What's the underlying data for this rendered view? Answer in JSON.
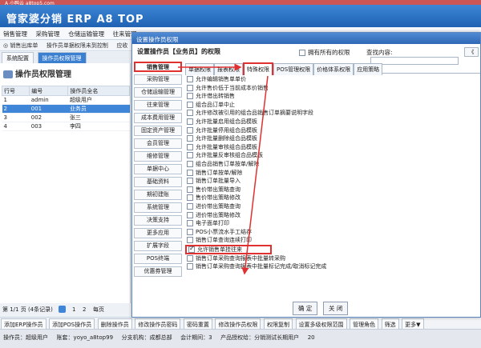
{
  "top_strip": "A 小鸭云 a8top5.com",
  "app_title": "管家婆分销 ERP A8 TOP",
  "menubar": [
    "销售管理",
    "采购管理",
    "仓储运输管理",
    "往来管理"
  ],
  "toolbar2": [
    "◎ 销售出库单",
    "操作员单据权限未到控制",
    "应收"
  ],
  "tabs": [
    "系统配置",
    "操作员权限管理"
  ],
  "left_panel": {
    "title": "操作员权限管理",
    "columns": [
      "行号",
      "编号",
      "操作员全名"
    ],
    "rows": [
      {
        "no": "1",
        "code": "admin",
        "name": "超级用户"
      },
      {
        "no": "2",
        "code": "001",
        "name": "业务员"
      },
      {
        "no": "3",
        "code": "002",
        "name": "张三"
      },
      {
        "no": "4",
        "code": "003",
        "name": "李四"
      }
    ]
  },
  "pager": {
    "info": "第 1/1 页 (4条记录)",
    "page": "1",
    "next": "2",
    "per": "每页"
  },
  "bottom_buttons": [
    "添加ERP操作员",
    "添加POS操作员",
    "删除操作员",
    "修改操作员密码",
    "密码重置",
    "修改操作员权限",
    "权限复制",
    "设置多级权限范围",
    "管理角色",
    "筛选",
    "更多▼"
  ],
  "status": [
    "操作员：超级用户",
    "账套：yoyo_a8top99",
    "分支机构：成都总部",
    "会计期间：3",
    "产品授权给：分销测试长期用户",
    "20"
  ],
  "dialog": {
    "title": "设置操作员权限",
    "subtitle": "设置操作员【业务员】的权限",
    "own_label": "拥有所有的权限",
    "search_label": "查找内容:",
    "scroll_btn": "《",
    "modules": [
      "销售管理",
      "采购管理",
      "仓储运输管理",
      "往来管理",
      "成本费用管理",
      "固定资产管理",
      "会员管理",
      "维修管理",
      "单据中心",
      "基础资料",
      "期初建账",
      "系统管理",
      "决策支持",
      "更多应用",
      "扩展字段",
      "POS终端",
      "优惠券管理"
    ],
    "tabs": [
      "单据权限",
      "报表权限",
      "特殊权限",
      "POS管理权限",
      "价格体系权限",
      "应用策略"
    ],
    "active_tab": 2,
    "permissions": [
      {
        "label": "允许编辑销售单单价",
        "checked": false
      },
      {
        "label": "允许售价低于当前成本价销售",
        "checked": false
      },
      {
        "label": "允许借出转销售",
        "checked": false
      },
      {
        "label": "组合品订单中止",
        "checked": false
      },
      {
        "label": "允许修改被引用的组合品销售订单摘要说明字段",
        "checked": false
      },
      {
        "label": "允许批量启用组合品模板",
        "checked": false
      },
      {
        "label": "允许批量停用组合品模板",
        "checked": false
      },
      {
        "label": "允许批量删除组合品模板",
        "checked": false
      },
      {
        "label": "允许批量审核组合品模板",
        "checked": false
      },
      {
        "label": "允许批量反审核组合品模板",
        "checked": false
      },
      {
        "label": "组合品销售订单按单/解除",
        "checked": false
      },
      {
        "label": "销售订单按单/解除",
        "checked": false
      },
      {
        "label": "销售订单批量导入",
        "checked": false
      },
      {
        "label": "售价带出策略查询",
        "checked": false
      },
      {
        "label": "售价带出策略修改",
        "checked": false
      },
      {
        "label": "进价带出策略查询",
        "checked": false
      },
      {
        "label": "进价带出策略修改",
        "checked": false
      },
      {
        "label": "电子面单打印",
        "checked": false
      },
      {
        "label": "POS小票流水手工结存",
        "checked": false
      },
      {
        "label": "销售订单查询连续打印",
        "checked": false
      },
      {
        "label": "允许销售单挂往来",
        "checked": true
      },
      {
        "label": "销售订单采购查询报表中批量转采购",
        "checked": false
      },
      {
        "label": "销售订单采购查询报表中批量标记完成/取消标记完成",
        "checked": false
      }
    ],
    "highlight_index": 20,
    "ok": "确 定",
    "close": "关 闭"
  },
  "colors": {
    "header": "#2a6dc0",
    "selected_row": "#3f86d8",
    "highlight": "#e03030"
  }
}
